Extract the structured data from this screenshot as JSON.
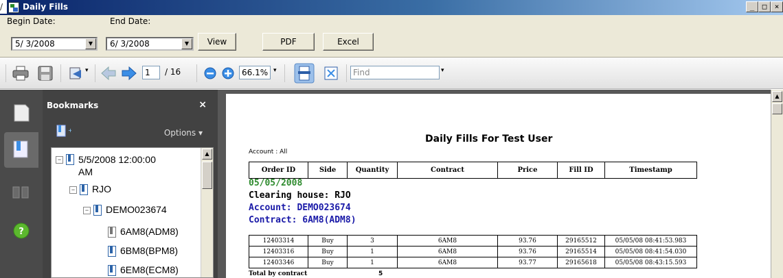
{
  "window": {
    "title": "Daily Fills",
    "corner_glyph": "/",
    "minimize": "_",
    "maximize": "□",
    "close": "×"
  },
  "datebar": {
    "begin_label": "Begin Date:",
    "begin_value": "5/ 3/2008",
    "end_label": "End Date:",
    "end_value": "6/ 3/2008",
    "view_label": "View",
    "pdf_label": "PDF",
    "excel_label": "Excel"
  },
  "toolbar": {
    "page_current": "1",
    "page_total": "/ 16",
    "zoom": "66.1%",
    "find_placeholder": "Find"
  },
  "bookmarks": {
    "title": "Bookmarks",
    "close": "×",
    "options": "Options ▾",
    "items": [
      {
        "label": "5/5/2008 12:00:00",
        "label2": "AM"
      },
      {
        "label": "RJO"
      },
      {
        "label": "DEMO023674"
      },
      {
        "label": "6AM8(ADM8)"
      },
      {
        "label": "6BM8(BPM8)"
      },
      {
        "label": "6EM8(ECM8)"
      }
    ]
  },
  "report": {
    "title": "Daily Fills For Test User",
    "account_line": "Account : All",
    "columns": [
      "Order ID",
      "Side",
      "Quantity",
      "Contract",
      "Price",
      "Fill ID",
      "Timestamp"
    ],
    "date": "05/05/2008",
    "clearing_house": "Clearing house: RJO",
    "account": "Account: DEMO023674",
    "contract": "Contract: 6AM8(ADM8)",
    "rows": [
      [
        "12403314",
        "Buy",
        "3",
        "6AM8",
        "93.76",
        "29165512",
        "05/05/08 08:41:53.983"
      ],
      [
        "12403316",
        "Buy",
        "1",
        "6AM8",
        "93.76",
        "29165514",
        "05/05/08 08:41:54.030"
      ],
      [
        "12403346",
        "Buy",
        "1",
        "6AM8",
        "93.77",
        "29165618",
        "05/05/08 08:43:15.593"
      ]
    ],
    "total_label": "Total by contract",
    "total_qty": "5"
  },
  "colors": {
    "date_green": "#2e8b2e",
    "account_blue": "#1a1aa8",
    "clearing_black": "#000000"
  }
}
